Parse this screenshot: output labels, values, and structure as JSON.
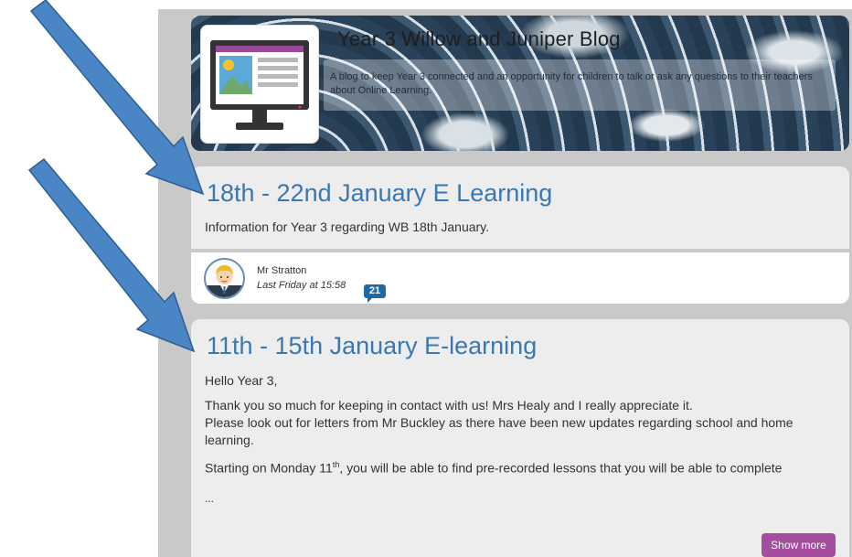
{
  "banner": {
    "title": "Year 3 Willow and Juniper Blog",
    "description": "A blog to keep Year 3 connected and an opportunity for children to talk or ask any questions to their teachers about Online Learning."
  },
  "posts": [
    {
      "title": "18th - 22nd January E Learning",
      "summary": "Information for Year 3 regarding WB 18th January.",
      "author": "Mr Stratton",
      "time": "Last Friday at 15:58",
      "comments": "21"
    },
    {
      "title": "11th - 15th January E-learning",
      "greeting": "Hello Year 3,",
      "para1_line1": "Thank you so much for keeping in contact with us! Mrs Healy and I really appreciate it.",
      "para1_line2": "Please look out for letters from Mr Buckley as there have been new updates regarding school and home learning.",
      "para2_pre": "Starting on Monday 11",
      "para2_sup": "th",
      "para2_post": ", you will be able to find pre-recorded lessons that you will be able to complete",
      "ellipsis": "...",
      "show_more": "Show more"
    }
  ],
  "colors": {
    "title_blue": "#3a78b2",
    "arrow_blue": "#4a86c5",
    "show_more": "#a54d9e",
    "badge": "#1e6aa6"
  },
  "icons": {
    "monitor": "computer-monitor-icon",
    "avatar": "teacher-avatar",
    "comments": "comment-bubble-icon"
  }
}
